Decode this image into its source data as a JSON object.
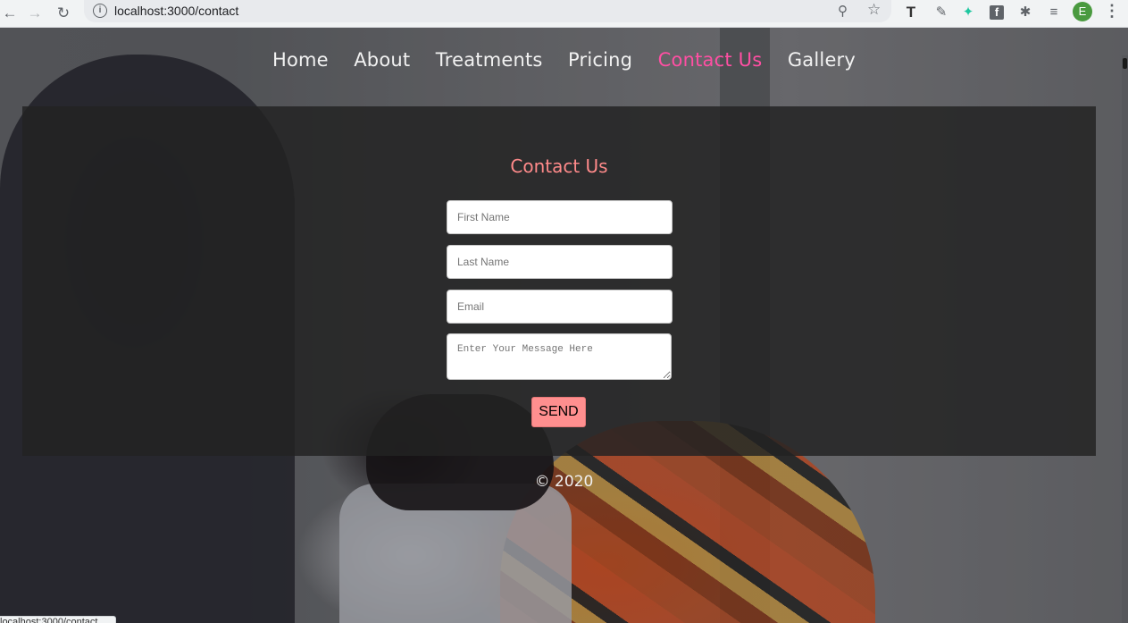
{
  "browser": {
    "url": "localhost:3000/contact",
    "status_url": "localhost:3000/contact",
    "profile_initial": "E",
    "icons": [
      "back-icon",
      "forward-icon",
      "reload-icon",
      "site-info-icon",
      "zoom-icon",
      "bookmark-star-icon",
      "extension-icons",
      "kebab-menu-icon"
    ]
  },
  "nav": {
    "items": [
      {
        "label": "Home"
      },
      {
        "label": "About"
      },
      {
        "label": "Treatments"
      },
      {
        "label": "Pricing"
      },
      {
        "label": "Contact Us",
        "active": true
      },
      {
        "label": "Gallery"
      }
    ]
  },
  "form": {
    "title": "Contact Us",
    "first_name_placeholder": "First Name",
    "last_name_placeholder": "Last Name",
    "email_placeholder": "Email",
    "message_placeholder": "Enter Your Message Here",
    "send_label": "SEND"
  },
  "footer": {
    "text": "© 2020"
  },
  "colors": {
    "accent_pink": "#ff4fa3",
    "title_salmon": "#ff8a8a",
    "button_salmon": "#ff8f8f"
  }
}
